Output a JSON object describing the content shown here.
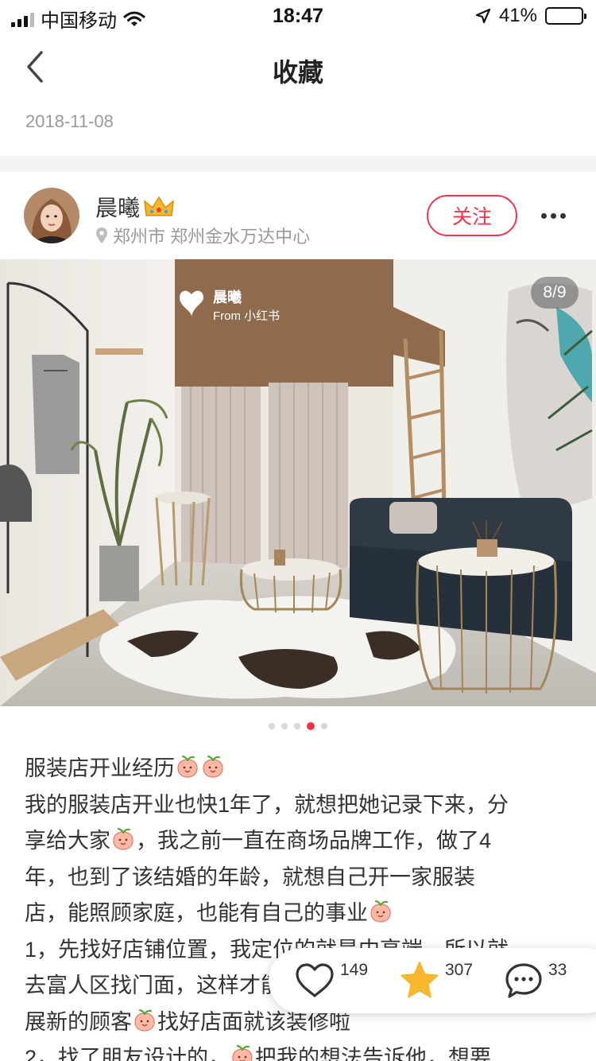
{
  "status_bar": {
    "carrier": "中国移动",
    "time": "18:47",
    "battery_percent": "41%",
    "battery_level": 0.41
  },
  "nav": {
    "title": "收藏"
  },
  "previous_post": {
    "date": "2018-11-08"
  },
  "post": {
    "author": {
      "name": "晨曦"
    },
    "location": "郑州市 郑州金水万达中心",
    "follow_label": "关注",
    "image_counter": "8/9",
    "image_index": 4,
    "image_dots_total": 5,
    "watermark": {
      "name": "晨曦",
      "source": "From 小红书"
    },
    "text_lines": [
      {
        "text": "服装店开业经历",
        "emoji_after": 2
      },
      {
        "text": "我的服装店开业也快1年了，就想把她记录下来，分",
        "emoji_after": 0
      },
      {
        "text": "享给大家",
        "emoji_after": 1,
        "text_after": "，我之前一直在商场品牌工作，做了4"
      },
      {
        "text": "年，也到了该结婚的年龄，就想自己开一家服装",
        "emoji_after": 0
      },
      {
        "text": "店，能照顾家庭，也能有自己的事业",
        "emoji_after": 1
      },
      {
        "text": "1，先找好店铺位置，我定位的就是中高端，所以就",
        "emoji_after": 0
      },
      {
        "text": "去富人区找门面，这样才能发",
        "emoji_after": 0
      },
      {
        "text": "展新的顾客",
        "emoji_after": 1,
        "text_after": "找好店面就该装修啦"
      },
      {
        "text": "2，找了朋友设计的，",
        "emoji_after": 1,
        "text_after": "把我的想法告诉他，想要"
      }
    ]
  },
  "actions": {
    "like_count": "149",
    "collect_count": "307",
    "comment_count": "33"
  },
  "colors": {
    "accent": "#f0344e",
    "star": "#f6b72e"
  }
}
